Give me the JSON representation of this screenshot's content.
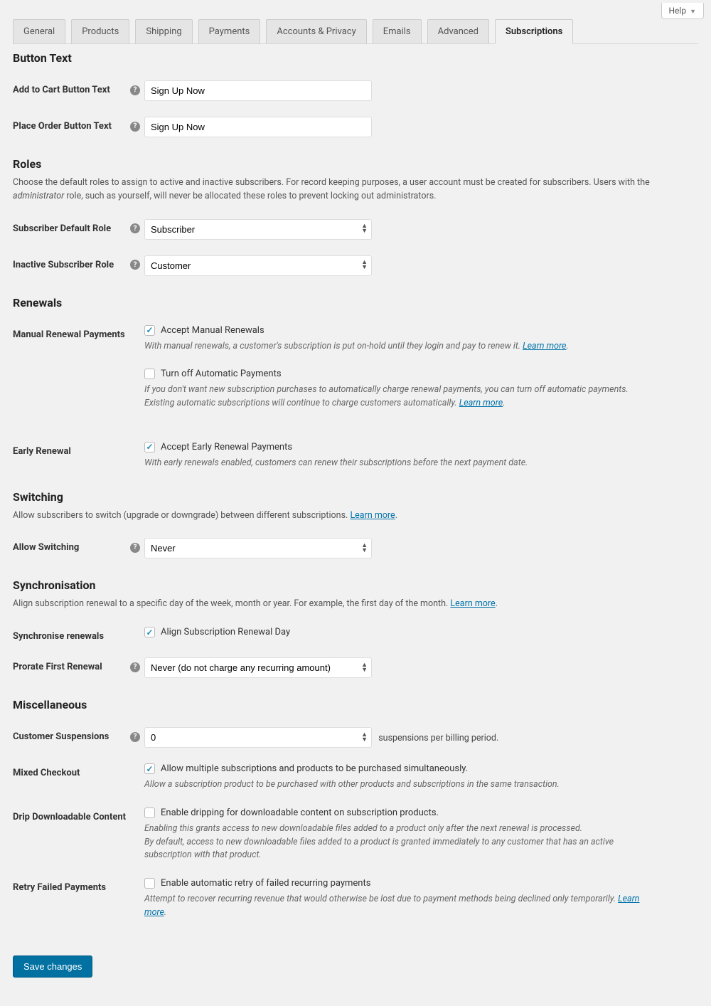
{
  "help": {
    "label": "Help"
  },
  "tabs": [
    "General",
    "Products",
    "Shipping",
    "Payments",
    "Accounts & Privacy",
    "Emails",
    "Advanced",
    "Subscriptions"
  ],
  "active_tab": "Subscriptions",
  "sections": {
    "button_text": {
      "title": "Button Text",
      "add_to_cart": {
        "label": "Add to Cart Button Text",
        "value": "Sign Up Now"
      },
      "place_order": {
        "label": "Place Order Button Text",
        "value": "Sign Up Now"
      }
    },
    "roles": {
      "title": "Roles",
      "desc_before": "Choose the default roles to assign to active and inactive subscribers. For record keeping purposes, a user account must be created for subscribers. Users with the ",
      "desc_em": "administrator",
      "desc_after": " role, such as yourself, will never be allocated these roles to prevent locking out administrators.",
      "default_role": {
        "label": "Subscriber Default Role",
        "value": "Subscriber"
      },
      "inactive_role": {
        "label": "Inactive Subscriber Role",
        "value": "Customer"
      }
    },
    "renewals": {
      "title": "Renewals",
      "manual": {
        "label": "Manual Renewal Payments",
        "accept_label": "Accept Manual Renewals",
        "accept_desc": "With manual renewals, a customer's subscription is put on-hold until they login and pay to renew it. ",
        "learn_more": "Learn more",
        "turn_off_label": "Turn off Automatic Payments",
        "turn_off_desc": "If you don't want new subscription purchases to automatically charge renewal payments, you can turn off automatic payments. Existing automatic subscriptions will continue to charge customers automatically. "
      },
      "early": {
        "label": "Early Renewal",
        "accept_label": "Accept Early Renewal Payments",
        "desc": "With early renewals enabled, customers can renew their subscriptions before the next payment date."
      }
    },
    "switching": {
      "title": "Switching",
      "desc": "Allow subscribers to switch (upgrade or downgrade) between different subscriptions. ",
      "learn_more": "Learn more",
      "allow": {
        "label": "Allow Switching",
        "value": "Never"
      }
    },
    "sync": {
      "title": "Synchronisation",
      "desc": "Align subscription renewal to a specific day of the week, month or year. For example, the first day of the month. ",
      "learn_more": "Learn more",
      "renewals": {
        "label": "Synchronise renewals",
        "check_label": "Align Subscription Renewal Day"
      },
      "prorate": {
        "label": "Prorate First Renewal",
        "value": "Never (do not charge any recurring amount)"
      }
    },
    "misc": {
      "title": "Miscellaneous",
      "suspensions": {
        "label": "Customer Suspensions",
        "value": "0",
        "suffix": "suspensions per billing period."
      },
      "mixed": {
        "label": "Mixed Checkout",
        "check_label": "Allow multiple subscriptions and products to be purchased simultaneously.",
        "desc": "Allow a subscription product to be purchased with other products and subscriptions in the same transaction."
      },
      "drip": {
        "label": "Drip Downloadable Content",
        "check_label": "Enable dripping for downloadable content on subscription products.",
        "desc1": "Enabling this grants access to new downloadable files added to a product only after the next renewal is processed.",
        "desc2": "By default, access to new downloadable files added to a product is granted immediately to any customer that has an active subscription with that product."
      },
      "retry": {
        "label": "Retry Failed Payments",
        "check_label": "Enable automatic retry of failed recurring payments",
        "desc": "Attempt to recover recurring revenue that would otherwise be lost due to payment methods being declined only temporarily. ",
        "learn_more": "Learn more"
      }
    },
    "save": "Save changes"
  }
}
